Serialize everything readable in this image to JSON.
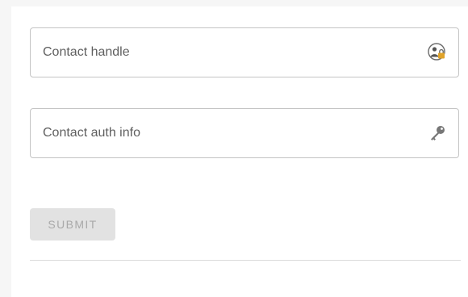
{
  "form": {
    "fields": [
      {
        "label": "Contact handle",
        "icon": "user-lock-icon"
      },
      {
        "label": "Contact auth info",
        "icon": "key-icon"
      }
    ],
    "submit_label": "SUBMIT",
    "submit_disabled": true
  },
  "colors": {
    "border": "#c4c4c4",
    "label": "#5f5f5f",
    "button_bg_disabled": "#e2e2e2",
    "button_text_disabled": "#a9a9a9",
    "lock_accent": "#e0a32a"
  }
}
